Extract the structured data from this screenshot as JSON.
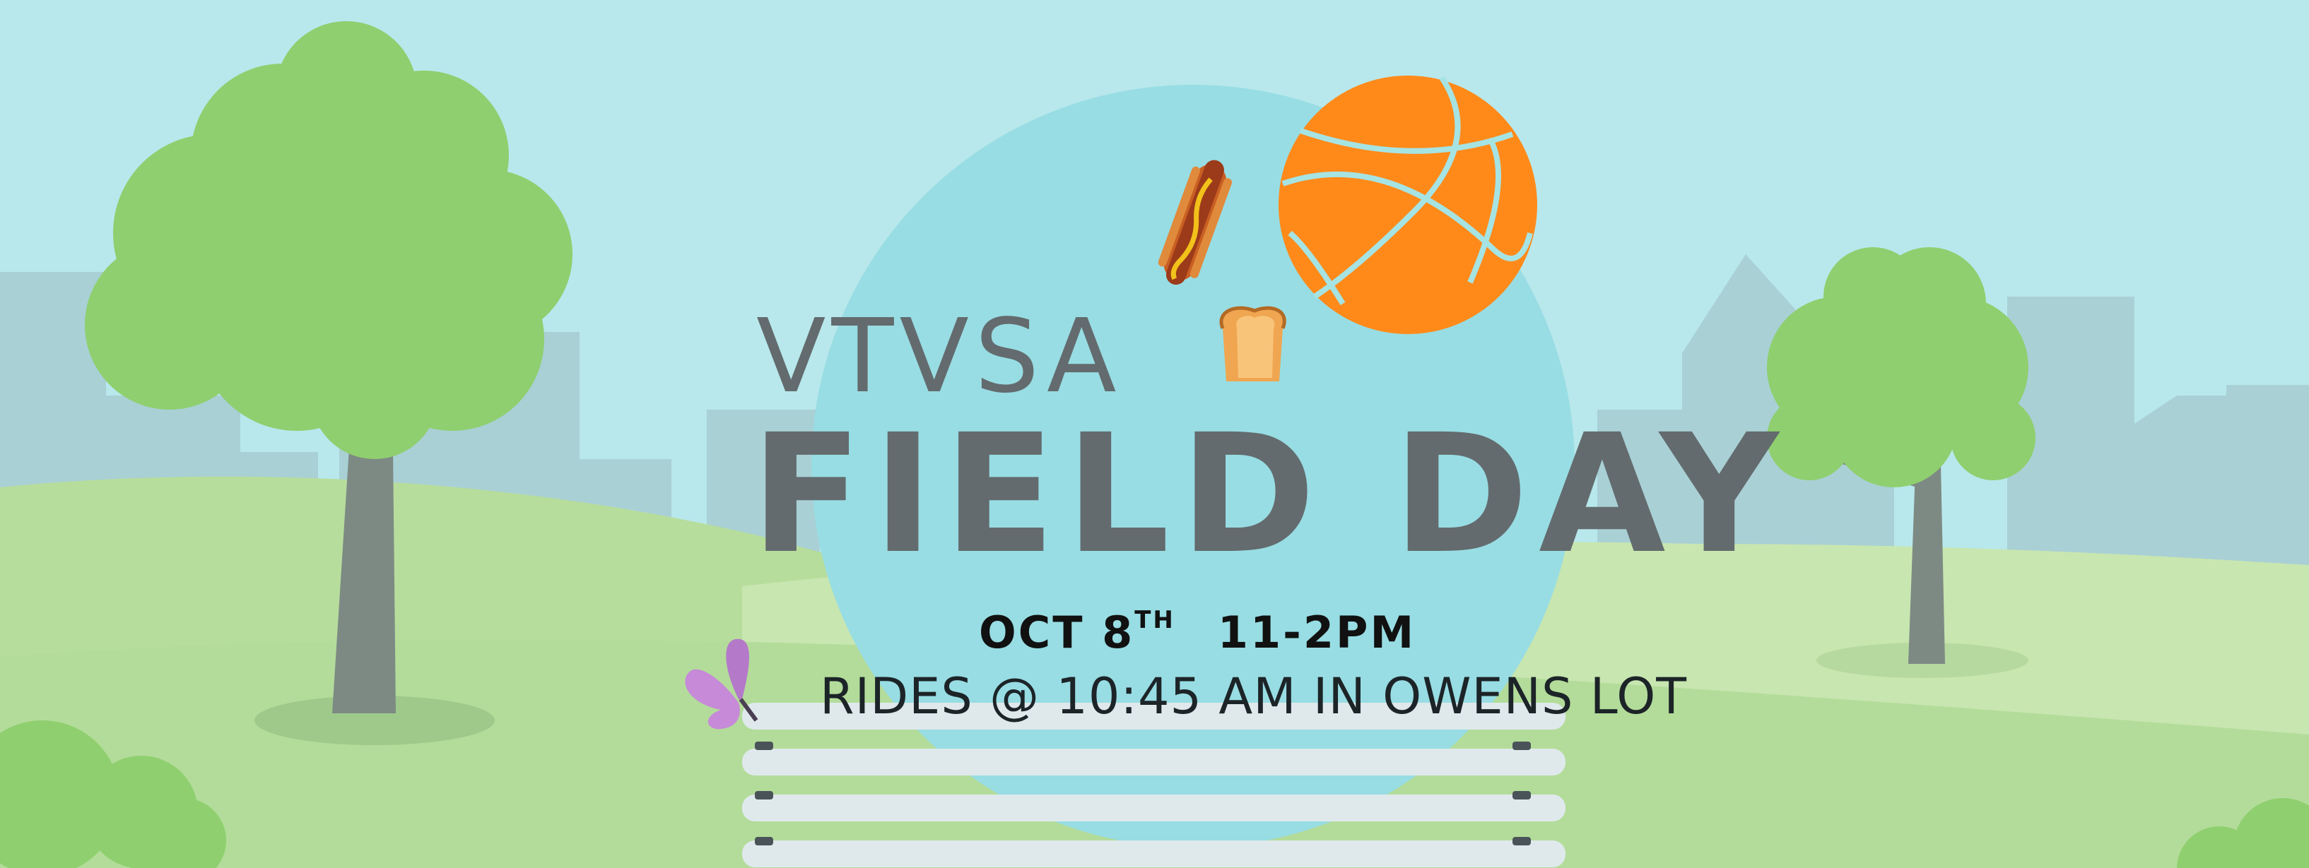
{
  "banner": {
    "org": "VTVSA",
    "title": "FIELD DAY",
    "date_month_day": "OCT 8",
    "date_suffix": "TH",
    "time": "11-2PM",
    "rides": "RIDES @ 10:45 AM IN OWENS LOT"
  },
  "icons": [
    "hotdog-icon",
    "bread-icon",
    "basketball-icon",
    "butterfly-icon"
  ],
  "colors": {
    "sky": "#b8e8ec",
    "circle": "#98dde3",
    "city": "#a9d0d5",
    "grass": "#b7dd9c",
    "tree_leaf": "#8fcf6f",
    "trunk": "#7d8a84",
    "text_gray": "#636b6e",
    "basketball": "#ff8a1a",
    "bench": "#dfe9ec"
  }
}
